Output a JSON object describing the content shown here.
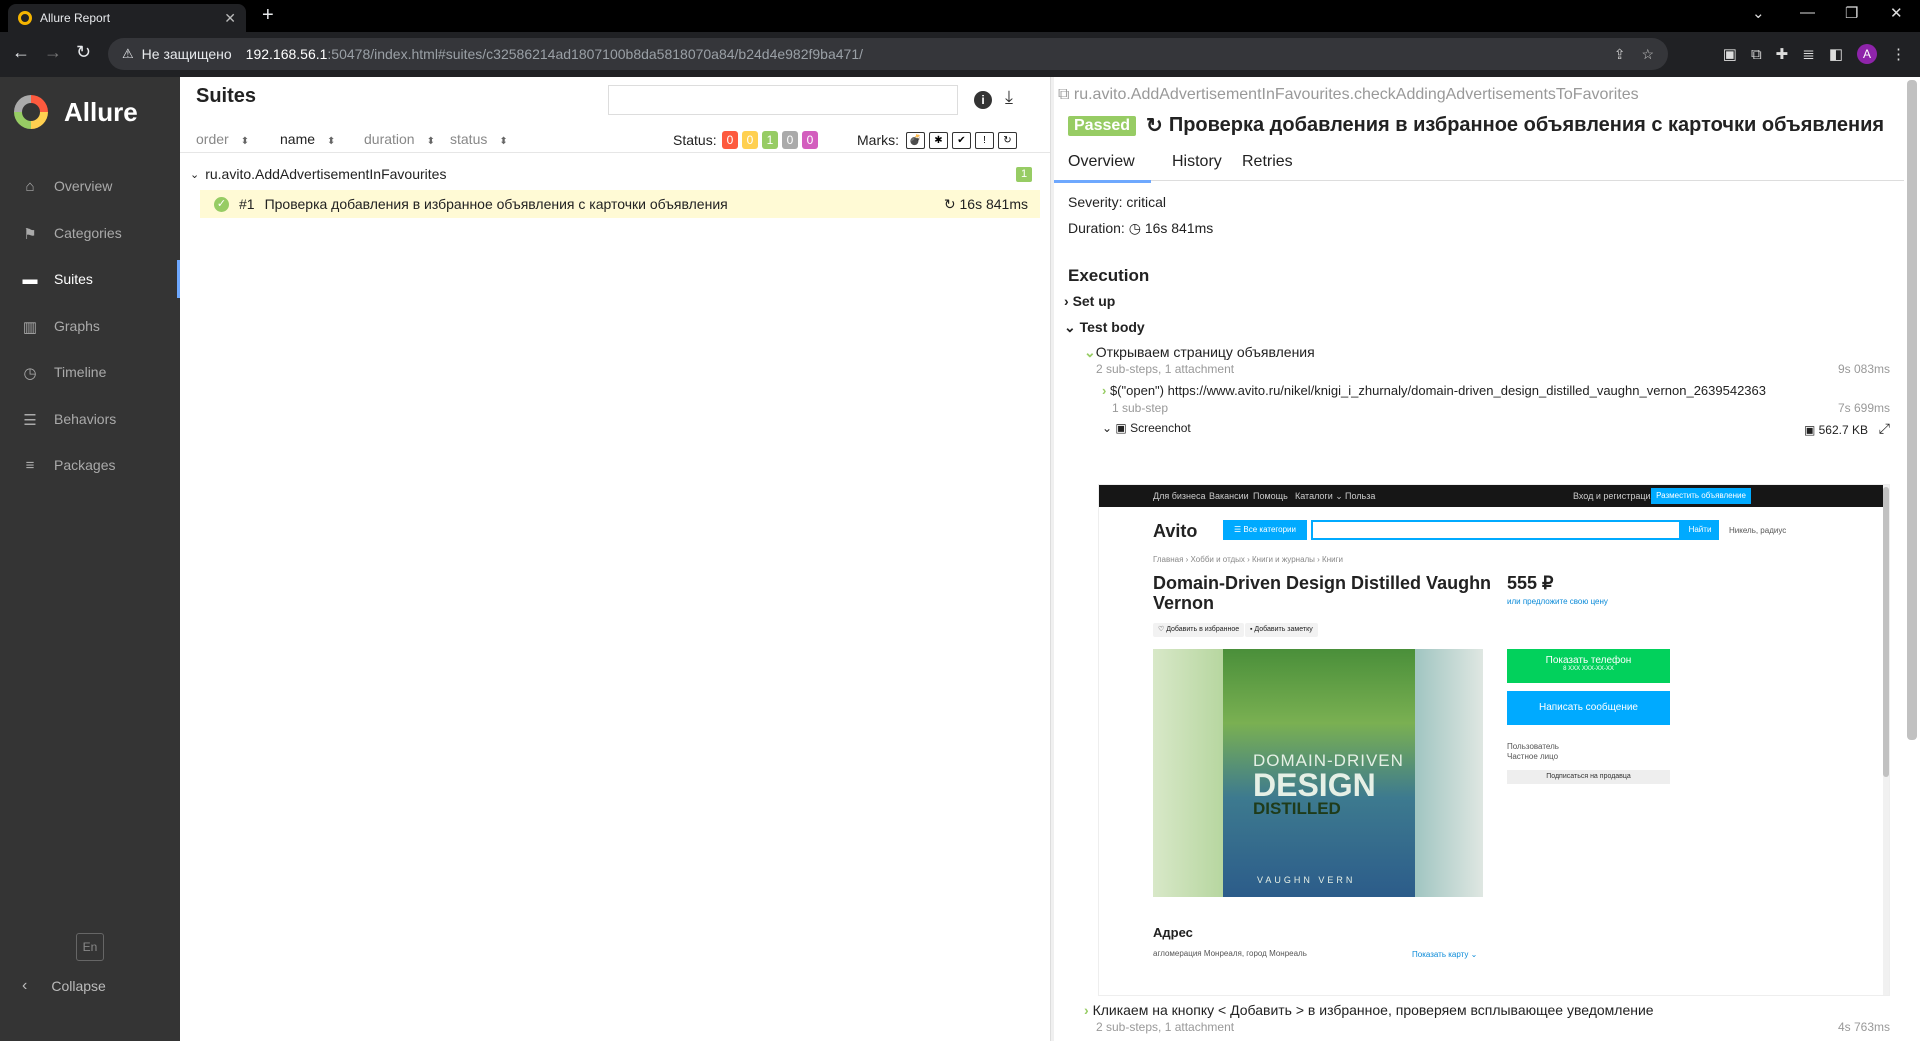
{
  "browser": {
    "tab_title": "Allure Report",
    "not_secure": "Не защищено",
    "url_host": "192.168.56.1",
    "url_path": ":50478/index.html#suites/c32586214ad1807100b8da5818070a84/b24d4e982f9ba471/",
    "avatar_letter": "A"
  },
  "sidebar": {
    "brand": "Allure",
    "items": [
      {
        "label": "Overview",
        "icon": "home-icon",
        "glyph": "⌂"
      },
      {
        "label": "Categories",
        "icon": "flag-icon",
        "glyph": "⚑"
      },
      {
        "label": "Suites",
        "icon": "briefcase-icon",
        "glyph": "▬"
      },
      {
        "label": "Graphs",
        "icon": "bar-chart-icon",
        "glyph": "▥"
      },
      {
        "label": "Timeline",
        "icon": "clock-icon",
        "glyph": "◷"
      },
      {
        "label": "Behaviors",
        "icon": "list-icon",
        "glyph": "☰"
      },
      {
        "label": "Packages",
        "icon": "align-left-icon",
        "glyph": "≡"
      }
    ],
    "active": "Suites",
    "lang": "En",
    "collapse": "Collapse"
  },
  "suites": {
    "title": "Suites",
    "sort": {
      "order": "order",
      "name": "name",
      "duration": "duration",
      "status": "status"
    },
    "status_label": "Status:",
    "status_counts": [
      {
        "value": "0",
        "color": "#fd5a3e"
      },
      {
        "value": "0",
        "color": "#ffd050"
      },
      {
        "value": "1",
        "color": "#97cc64"
      },
      {
        "value": "0",
        "color": "#aaaaaa"
      },
      {
        "value": "0",
        "color": "#d35ebe"
      }
    ],
    "marks_label": "Marks:",
    "group": {
      "name": "ru.avito.AddAdvertisementInFavourites",
      "count": "1"
    },
    "test": {
      "number": "#1",
      "name": "Проверка добавления в избранное объявления с карточки объявления",
      "duration": "16s 841ms"
    }
  },
  "detail": {
    "full_name": "ru.avito.AddAdvertisementInFavourites.checkAddingAdvertisementsToFavorites",
    "status": "Passed",
    "title": "Проверка добавления в избранное объявления с карточки объявления",
    "tabs": [
      "Overview",
      "History",
      "Retries"
    ],
    "severity": "Severity: critical",
    "duration_label": "Duration:",
    "duration": "16s 841ms",
    "execution": "Execution",
    "setup": "Set up",
    "test_body": "Test body",
    "step1": {
      "name": "Открываем страницу объявления",
      "meta": "2 sub-steps, 1 attachment",
      "time": "9s 083ms"
    },
    "step1a": {
      "name": "$(\"open\") https://www.avito.ru/nikel/knigi_i_zhurnaly/domain-driven_design_distilled_vaughn_vernon_2639542363",
      "meta": "1 sub-step",
      "time": "7s 699ms"
    },
    "attachment": {
      "name": "Screenchot",
      "size": "562.7 KB"
    },
    "step2": {
      "name": "Кликаем на кнопку < Добавить > в избранное, проверяем всплывающее уведомление",
      "meta": "2 sub-steps, 1 attachment",
      "time": "4s 763ms"
    }
  },
  "screenshot": {
    "topnav": [
      "Для бизнеса",
      "Вакансии",
      "Помощь",
      "Каталоги ⌄",
      "Польза"
    ],
    "login": "Вход и регистрация",
    "post_ad": "Разместить объявление",
    "logo": "Avito",
    "all_categories": "☰ Все категории",
    "find": "Найти",
    "location": "Никель, радиус",
    "breadcrumbs": "Главная › Хобби и отдых › Книги и журналы › Книги",
    "title": "Domain-Driven Design Distilled Vaughn Vernon",
    "price": "555 ₽",
    "offer": "или предложите свою цену",
    "fav": "♡ Добавить в избранное",
    "note": "▪ Добавить заметку",
    "book_line1": "DOMAIN-DRIVEN",
    "book_line2": "DESIGN",
    "book_line3": "DISTILLED",
    "book_author": "VAUGHN VERN",
    "show_phone": "Показать телефон",
    "phone": "8 XXX XXX-XX-XX",
    "write": "Написать сообщение",
    "user": "Пользователь",
    "private": "Частное лицо",
    "subscribe": "Подписаться на продавца",
    "address_h": "Адрес",
    "address": "агломерация Монреаля, город Монреаль",
    "show_map": "Показать карту ⌄"
  }
}
